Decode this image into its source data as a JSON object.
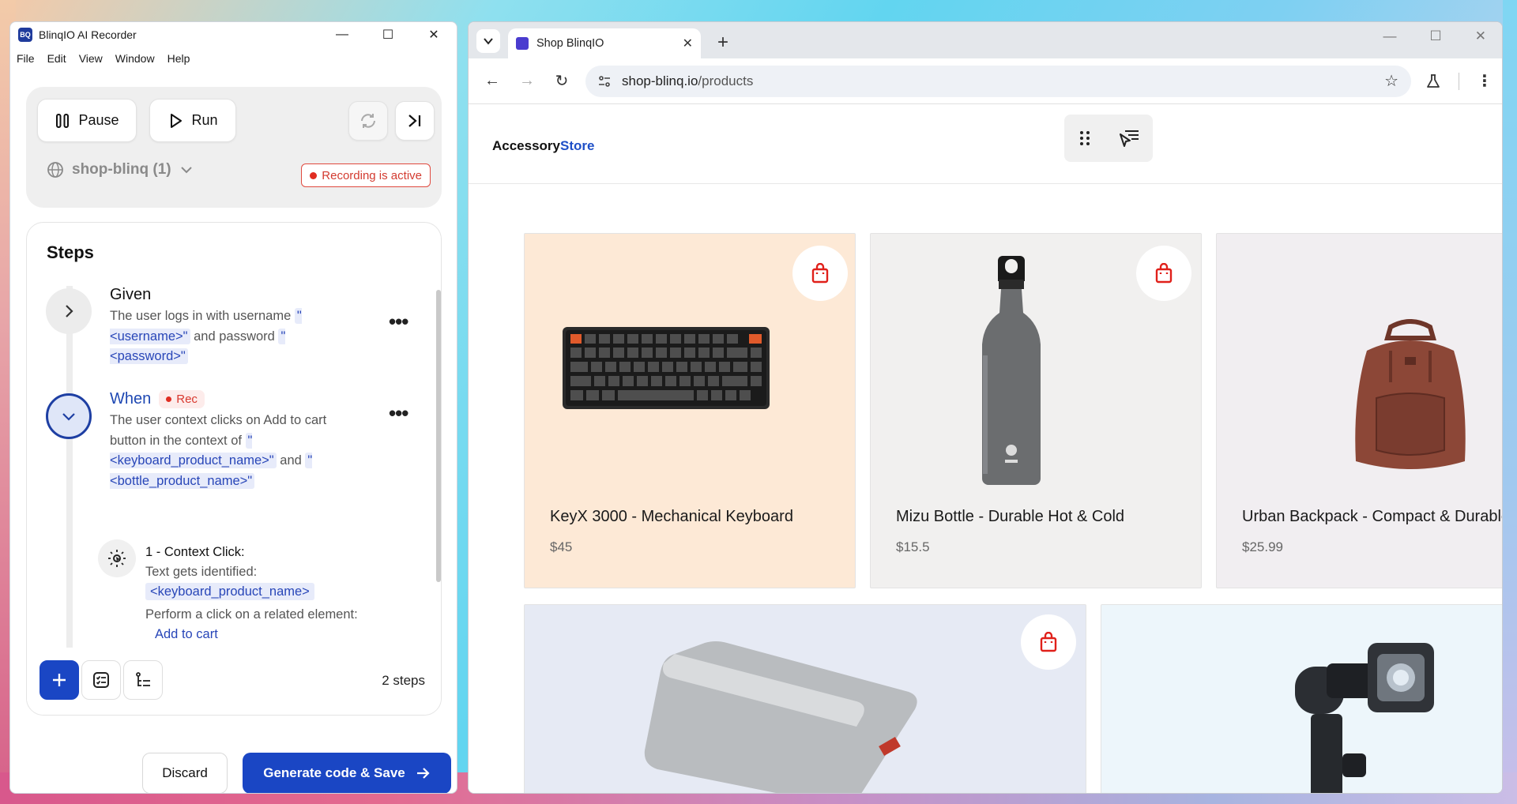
{
  "recorder": {
    "title": "BlinqIO AI Recorder",
    "app_icon": "BQ",
    "menu": [
      "File",
      "Edit",
      "View",
      "Window",
      "Help"
    ],
    "controls": {
      "pause_label": "Pause",
      "run_label": "Run",
      "project": "shop-blinq (1)",
      "recording_status": "Recording is active"
    },
    "steps": {
      "heading": "Steps",
      "given": {
        "keyword": "Given",
        "text_1": "The user logs in with username",
        "param_1": "\"<username>\"",
        "text_2": "and password",
        "param_2": "\"<password>\""
      },
      "when": {
        "keyword": "When",
        "rec_label": "Rec",
        "text_1": "The user context clicks on Add to cart button in the context of",
        "param_1": "\"<keyboard_product_name>\"",
        "text_2": "and",
        "param_2": "\"<bottle_product_name>\""
      },
      "substep": {
        "title": "1 - Context Click:",
        "line_1": "Text gets identified:",
        "param": "<keyboard_product_name>",
        "line_2": "Perform a click on a related element:",
        "link": "Add to cart"
      },
      "count": "2 steps"
    },
    "discard_label": "Discard",
    "save_label": "Generate code & Save"
  },
  "browser": {
    "tab_title": "Shop BlinqIO",
    "url_host": "shop-blinq.io",
    "url_path": "/products"
  },
  "store": {
    "logo_part1": "Accessory",
    "logo_part2": "Store",
    "products": [
      {
        "name": "KeyX 3000 - Mechanical Keyboard",
        "price": "$45"
      },
      {
        "name": "Mizu Bottle - Durable Hot & Cold",
        "price": "$15.5"
      },
      {
        "name": "Urban Backpack - Compact & Durable",
        "price": "$25.99"
      }
    ]
  },
  "colors": {
    "brand_blue": "#1a46c4",
    "recording_red": "#e02d22",
    "keyboard_card_bg": "#fde9d6",
    "bottle_card_bg": "#f1f0ef",
    "backpack_card_bg": "#f1eef1",
    "powerbank_card_bg": "#e6eaf4",
    "camera_card_bg": "#edf6fb"
  }
}
